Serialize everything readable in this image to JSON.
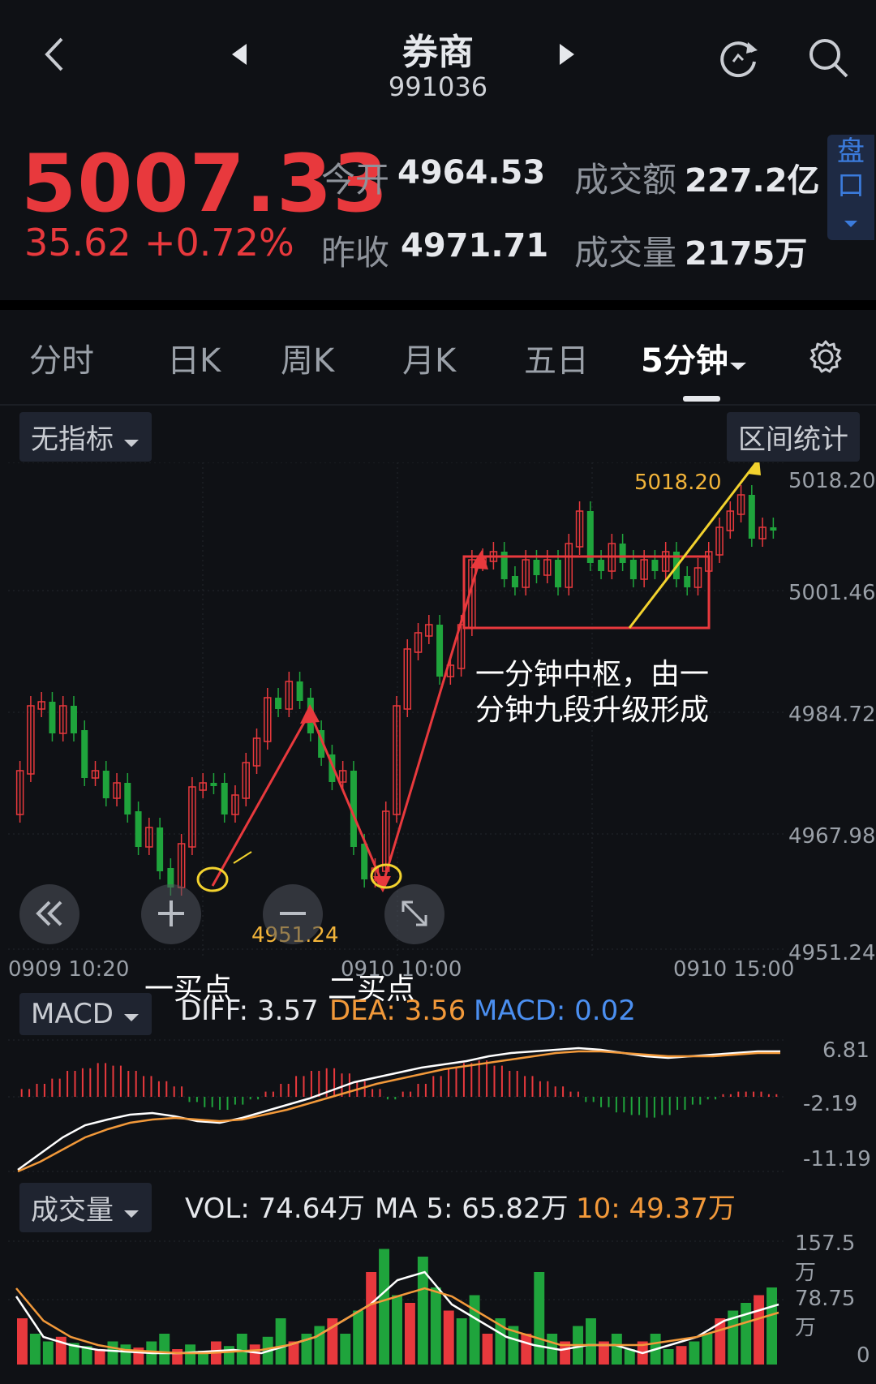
{
  "header": {
    "title": "券商",
    "code": "991036",
    "back_icon": "chevron-left-icon",
    "prev_icon": "triangle-left-icon",
    "next_icon": "triangle-right-icon",
    "refresh_icon": "refresh-icon",
    "search_icon": "search-icon"
  },
  "quote": {
    "price": "5007.33",
    "change": "35.62",
    "change_pct": "+0.72%",
    "open_label": "今开",
    "open_value": "4964.53",
    "prev_close_label": "昨收",
    "prev_close_value": "4971.71",
    "amount_label": "成交额",
    "amount_value": "227.2亿",
    "volume_label": "成交量",
    "volume_value": "2175万",
    "pankou_label_1": "盘",
    "pankou_label_2": "口",
    "up_color": "#e8393d"
  },
  "tabs": [
    {
      "label": "分时"
    },
    {
      "label": "日K"
    },
    {
      "label": "周K"
    },
    {
      "label": "月K"
    },
    {
      "label": "五日"
    },
    {
      "label": "5分钟",
      "active": true
    }
  ],
  "toolbar": {
    "indicator_label": "无指标",
    "range_stats_label": "区间统计"
  },
  "main_chart": {
    "y_ticks": [
      "5018.20",
      "5001.46",
      "4984.72",
      "4967.98",
      "4951.24"
    ],
    "x_ticks": [
      "0909 10:20",
      "0910 10:00",
      "0910 15:00"
    ],
    "high_label": "5018.20",
    "low_label": "4951.24",
    "annotations": {
      "buy1": "一买点",
      "buy2": "二买点",
      "pivot_line1": "一分钟中枢，由一",
      "pivot_line2": "分钟九段升级形成"
    }
  },
  "macd": {
    "selector_label": "MACD",
    "diff": "DIFF: 3.57",
    "dea": "DEA: 3.56",
    "macd": "MACD: 0.02",
    "y_ticks": [
      "6.81",
      "-2.19",
      "-11.19"
    ]
  },
  "volume": {
    "selector_label": "成交量",
    "vol": "VOL: 74.64万",
    "ma5": "MA 5: 65.82万",
    "ma10": "10: 49.37万",
    "y_ticks": [
      "157.5万",
      "78.75万",
      "0"
    ]
  }
}
